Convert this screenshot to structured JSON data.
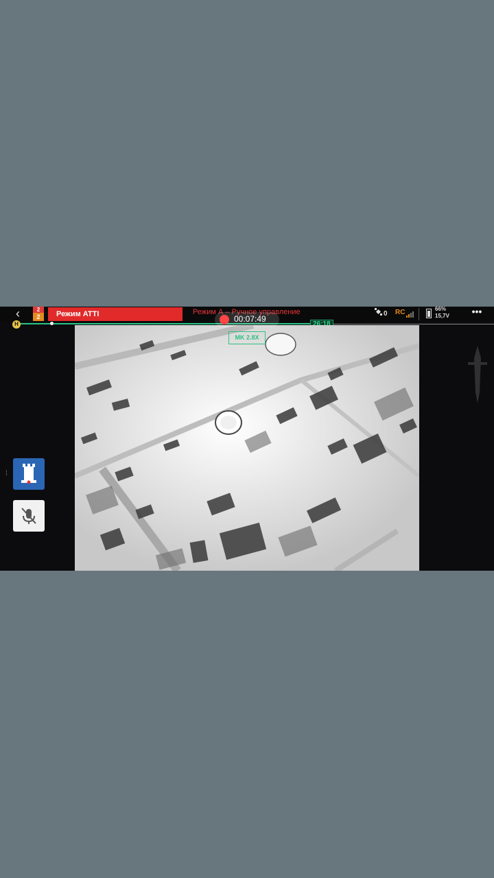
{
  "topbar": {
    "back_glyph": "‹",
    "level_top": "2",
    "level_bottom": "2",
    "mode_label": "Режим ATTI",
    "mode_warning": "Режим А – Ручное управление",
    "satellites": "0",
    "rc_label": "RC",
    "battery_percent": "66%",
    "battery_voltage": "15,7V",
    "more_glyph": "•••"
  },
  "progress": {
    "home_label": "H",
    "distance": "26:18",
    "fraction_done": 0.62
  },
  "recording": {
    "time": "00:07:49"
  },
  "feed": {
    "target_label": "MK 2.8X"
  },
  "colors": {
    "page_bg": "#68767e",
    "mode_banner": "#e12a2a",
    "accent_green": "#29c487",
    "level_orange": "#e48a1f",
    "record_red": "#ff4545",
    "mode_tile_blue": "#2b66b4"
  },
  "icons": {
    "back": "chevron-left-icon",
    "satellite": "satellite-icon",
    "rc_signal": "signal-bars-icon",
    "battery": "battery-icon",
    "more": "more-dots-icon",
    "mode_tile": "tower-mode-icon",
    "mic_tile": "mic-muted-icon",
    "watermark": "dagger-emblem-icon"
  }
}
